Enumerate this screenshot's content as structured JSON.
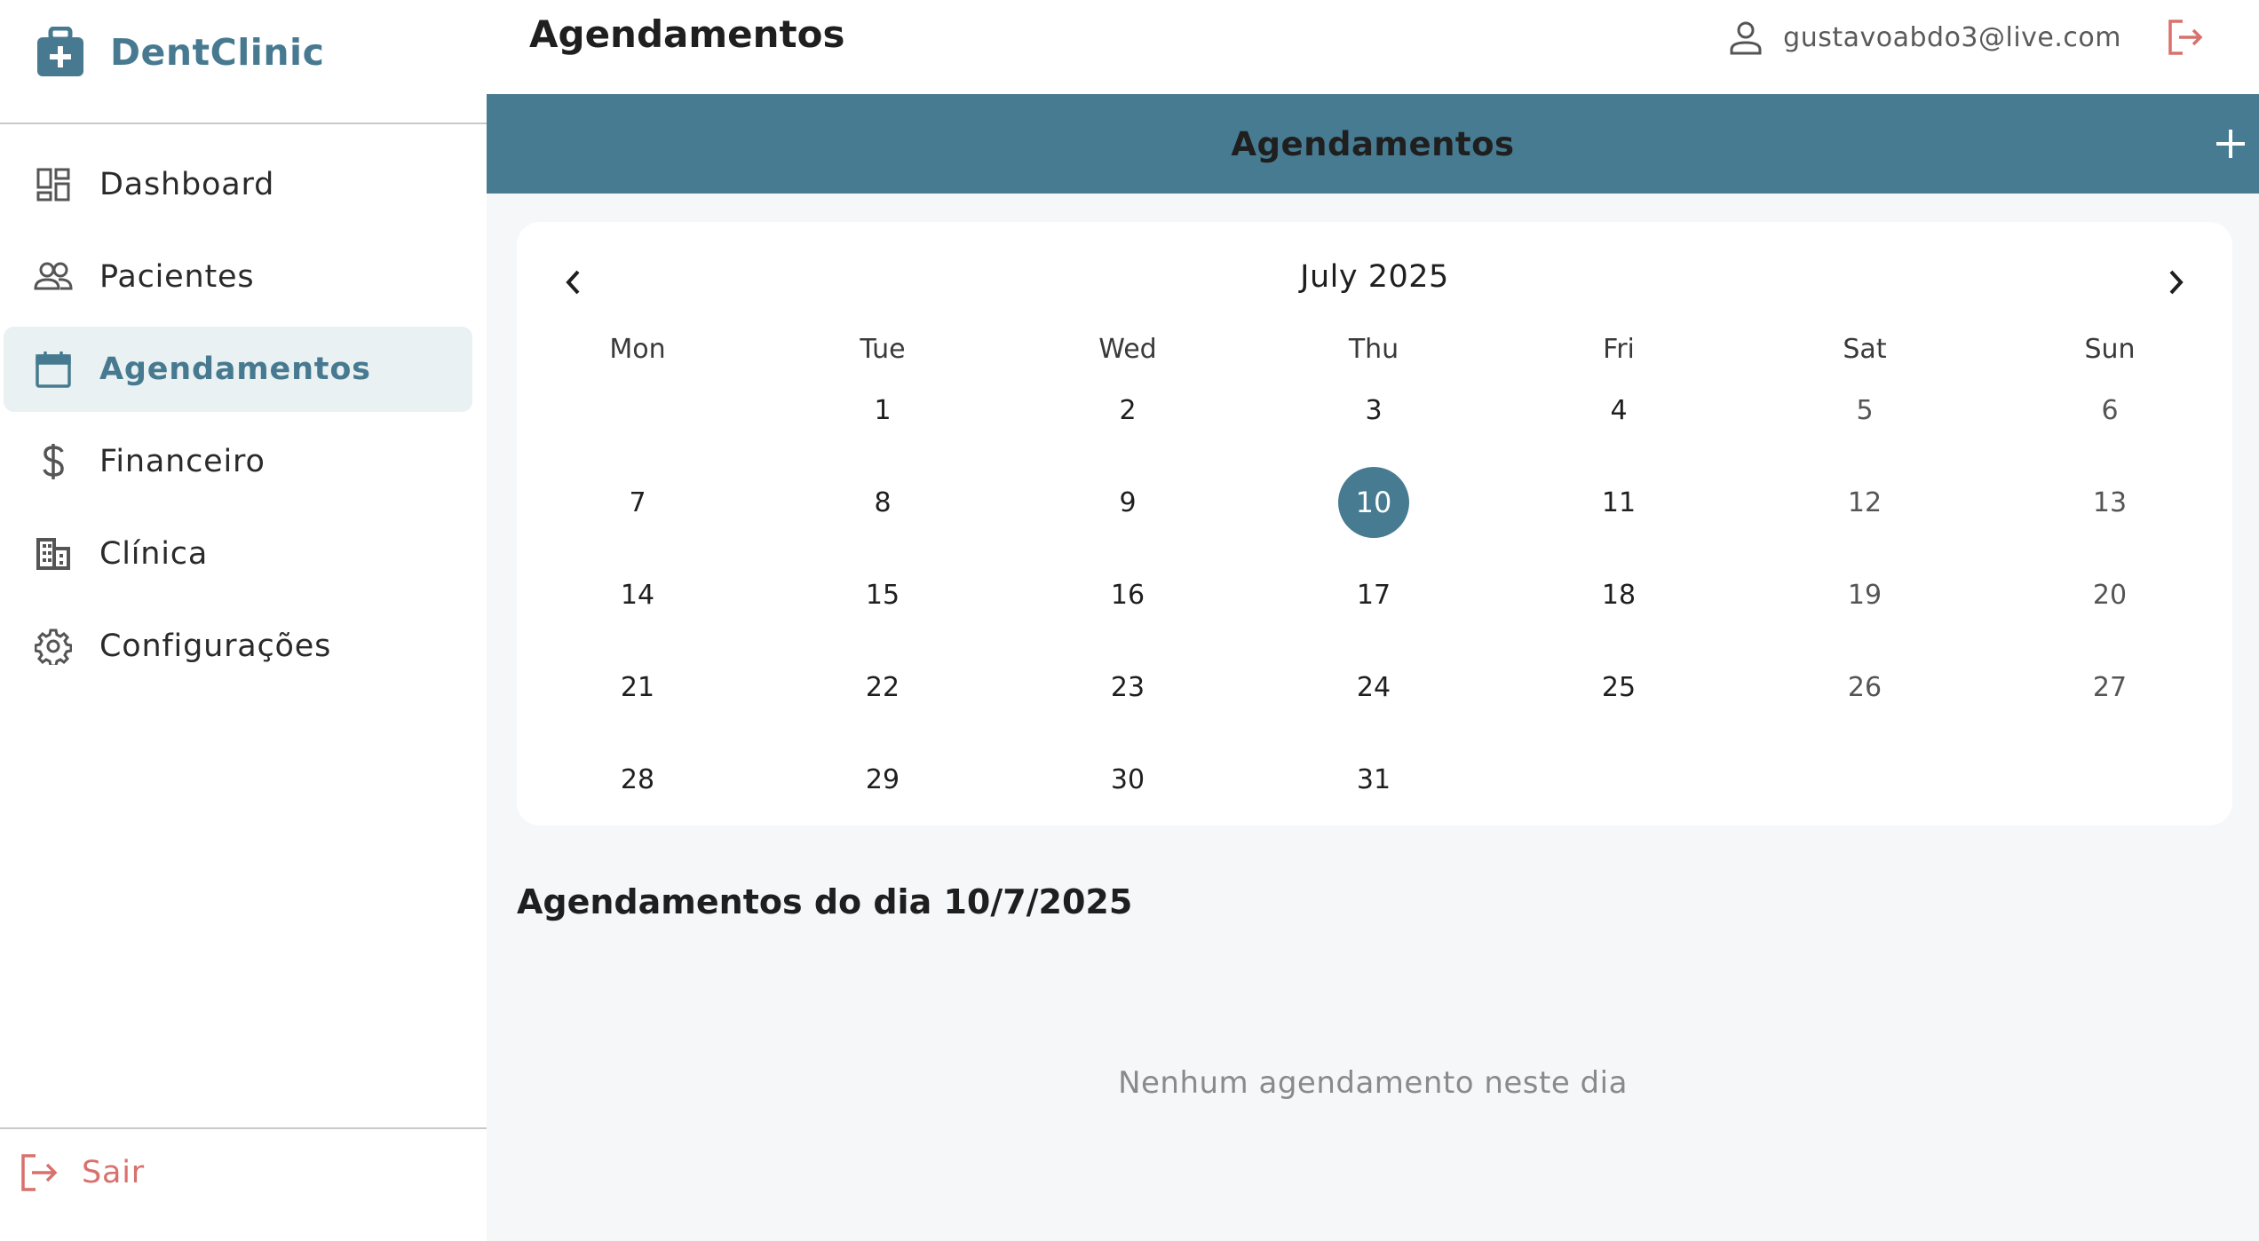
{
  "app": {
    "name": "DentClinic"
  },
  "sidebar": {
    "items": [
      {
        "label": "Dashboard",
        "icon": "dashboard-icon",
        "active": false
      },
      {
        "label": "Pacientes",
        "icon": "people-icon",
        "active": false
      },
      {
        "label": "Agendamentos",
        "icon": "calendar-icon",
        "active": true
      },
      {
        "label": "Financeiro",
        "icon": "dollar-icon",
        "active": false
      },
      {
        "label": "Clínica",
        "icon": "building-icon",
        "active": false
      },
      {
        "label": "Configurações",
        "icon": "gear-icon",
        "active": false
      }
    ],
    "logout_label": "Sair"
  },
  "topbar": {
    "title": "Agendamentos",
    "user_email": "gustavoabdo3@live.com"
  },
  "section": {
    "title": "Agendamentos"
  },
  "calendar": {
    "month_label": "July 2025",
    "weekdays": [
      "Mon",
      "Tue",
      "Wed",
      "Thu",
      "Fri",
      "Sat",
      "Sun"
    ],
    "first_weekday_index": 1,
    "days_in_month": 31,
    "selected_day": 10
  },
  "day_view": {
    "heading": "Agendamentos do dia 10/7/2025",
    "empty_message": "Nenhum agendamento neste dia"
  },
  "colors": {
    "accent": "#467b91",
    "logout": "#d8716c",
    "active_bg": "#e9f1f3"
  }
}
